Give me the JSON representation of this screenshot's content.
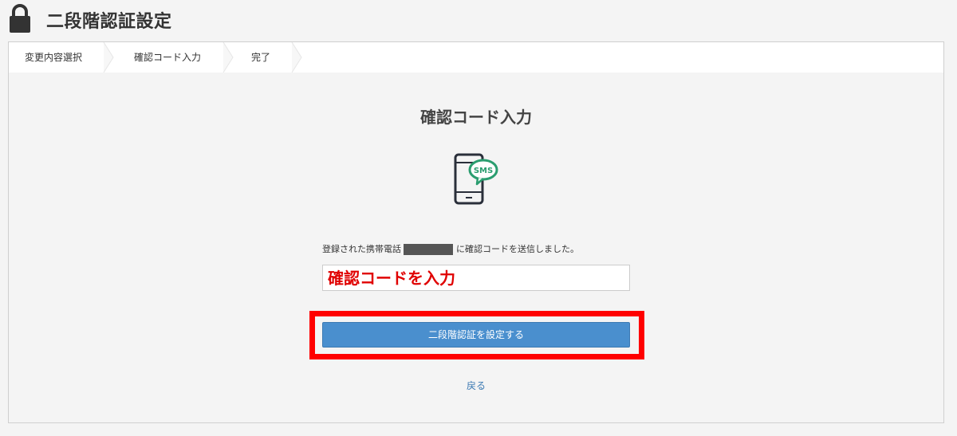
{
  "header": {
    "title": "二段階認証設定",
    "icon": "lock-icon"
  },
  "steps": [
    {
      "label": "変更内容選択"
    },
    {
      "label": "確認コード入力"
    },
    {
      "label": "完了"
    }
  ],
  "main": {
    "title": "確認コード入力",
    "phone_icon": "phone-sms-icon",
    "sms_badge": "SMS",
    "message_prefix": "登録された携帯電話",
    "message_suffix": "に確認コードを送信しました。",
    "code_input": {
      "placeholder": "確認コードを入力",
      "value": ""
    },
    "submit_label": "二段階認証を設定する",
    "back_label": "戻る"
  },
  "colors": {
    "accent": "#4a8fce",
    "highlight": "#ff0000",
    "sms_green": "#2a9d6f",
    "link": "#3d7ab3"
  }
}
